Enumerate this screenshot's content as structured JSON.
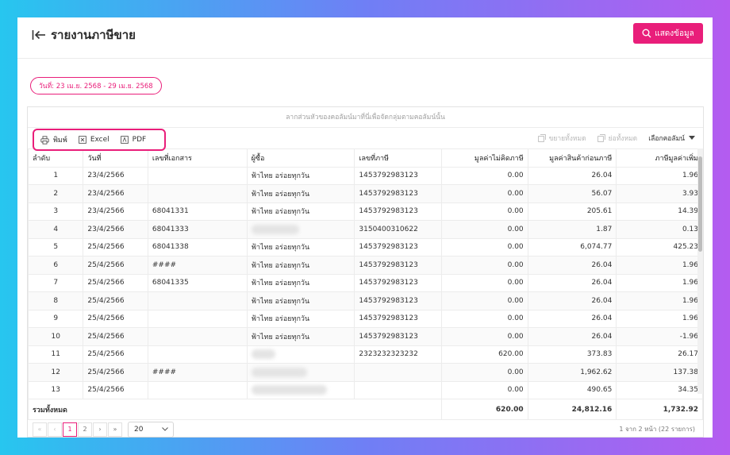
{
  "header": {
    "title": "รายงานภาษีขาย",
    "show_button": "แสดงข้อมูล"
  },
  "date_range": "วันที่: 23 เม.ย. 2568 - 29 เม.ย. 2568",
  "group_hint": "ลากส่วนหัวของคอลัมน์มาที่นี่เพื่อจัดกลุ่มตามคอลัมน์นั้น",
  "toolbar": {
    "print": "พิมพ์",
    "excel": "Excel",
    "pdf": "PDF",
    "expand_all": "ขยายทั้งหมด",
    "collapse_all": "ย่อทั้งหมด",
    "choose_columns": "เลือกคอลัมน์"
  },
  "columns": [
    "ลำดับ",
    "วันที่",
    "เลขที่เอกสาร",
    "ผู้ซื้อ",
    "เลขที่ภาษี",
    "มูลค่าไม่คิดภาษี",
    "มูลค่าสินค้าก่อนภาษี",
    "ภาษีมูลค่าเพิ่ม"
  ],
  "rows": [
    {
      "no": "1",
      "date": "23/4/2566",
      "doc": "",
      "buyer": "ฟ้าไทย อร่อยทุกวัน",
      "buyer_hidden": false,
      "tax": "1453792983123",
      "nontax": "0.00",
      "pre": "26.04",
      "vat": "1.96"
    },
    {
      "no": "2",
      "date": "23/4/2566",
      "doc": "",
      "buyer": "ฟ้าไทย อร่อยทุกวัน",
      "buyer_hidden": false,
      "tax": "1453792983123",
      "nontax": "0.00",
      "pre": "56.07",
      "vat": "3.93"
    },
    {
      "no": "3",
      "date": "23/4/2566",
      "doc": "68041331",
      "buyer": "ฟ้าไทย อร่อยทุกวัน",
      "buyer_hidden": false,
      "tax": "1453792983123",
      "nontax": "0.00",
      "pre": "205.61",
      "vat": "14.39"
    },
    {
      "no": "4",
      "date": "23/4/2566",
      "doc": "68041333",
      "buyer": "",
      "buyer_hidden": true,
      "tax": "3150400310622",
      "nontax": "0.00",
      "pre": "1.87",
      "vat": "0.13"
    },
    {
      "no": "5",
      "date": "25/4/2566",
      "doc": "68041338",
      "buyer": "ฟ้าไทย อร่อยทุกวัน",
      "buyer_hidden": false,
      "tax": "1453792983123",
      "nontax": "0.00",
      "pre": "6,074.77",
      "vat": "425.23"
    },
    {
      "no": "6",
      "date": "25/4/2566",
      "doc": "####",
      "buyer": "ฟ้าไทย อร่อยทุกวัน",
      "buyer_hidden": false,
      "tax": "1453792983123",
      "nontax": "0.00",
      "pre": "26.04",
      "vat": "1.96"
    },
    {
      "no": "7",
      "date": "25/4/2566",
      "doc": "68041335",
      "buyer": "ฟ้าไทย อร่อยทุกวัน",
      "buyer_hidden": false,
      "tax": "1453792983123",
      "nontax": "0.00",
      "pre": "26.04",
      "vat": "1.96"
    },
    {
      "no": "8",
      "date": "25/4/2566",
      "doc": "",
      "buyer": "ฟ้าไทย อร่อยทุกวัน",
      "buyer_hidden": false,
      "tax": "1453792983123",
      "nontax": "0.00",
      "pre": "26.04",
      "vat": "1.96"
    },
    {
      "no": "9",
      "date": "25/4/2566",
      "doc": "",
      "buyer": "ฟ้าไทย อร่อยทุกวัน",
      "buyer_hidden": false,
      "tax": "1453792983123",
      "nontax": "0.00",
      "pre": "26.04",
      "vat": "1.96"
    },
    {
      "no": "10",
      "date": "25/4/2566",
      "doc": "",
      "buyer": "ฟ้าไทย อร่อยทุกวัน",
      "buyer_hidden": false,
      "tax": "1453792983123",
      "nontax": "0.00",
      "pre": "26.04",
      "vat": "-1.96"
    },
    {
      "no": "11",
      "date": "25/4/2566",
      "doc": "",
      "buyer": "",
      "buyer_hidden": true,
      "tax": "2323232323232",
      "nontax": "620.00",
      "pre": "373.83",
      "vat": "26.17"
    },
    {
      "no": "12",
      "date": "25/4/2566",
      "doc": "####",
      "buyer": "",
      "buyer_hidden": true,
      "tax": "",
      "nontax": "0.00",
      "pre": "1,962.62",
      "vat": "137.38"
    },
    {
      "no": "13",
      "date": "25/4/2566",
      "doc": "",
      "buyer": "",
      "buyer_hidden": true,
      "tax": "",
      "nontax": "0.00",
      "pre": "490.65",
      "vat": "34.35"
    }
  ],
  "totals": {
    "label": "รวมทั้งหมด",
    "nontax": "620.00",
    "pre": "24,812.16",
    "vat": "1,732.92"
  },
  "pagination": {
    "first": "«",
    "prev": "‹",
    "pages": [
      "1",
      "2"
    ],
    "current": "1",
    "next": "›",
    "last": "»",
    "page_size": "20",
    "info": "1 จาก 2 หน้า (22 รายการ)"
  },
  "colors": {
    "accent": "#e91e7a"
  }
}
